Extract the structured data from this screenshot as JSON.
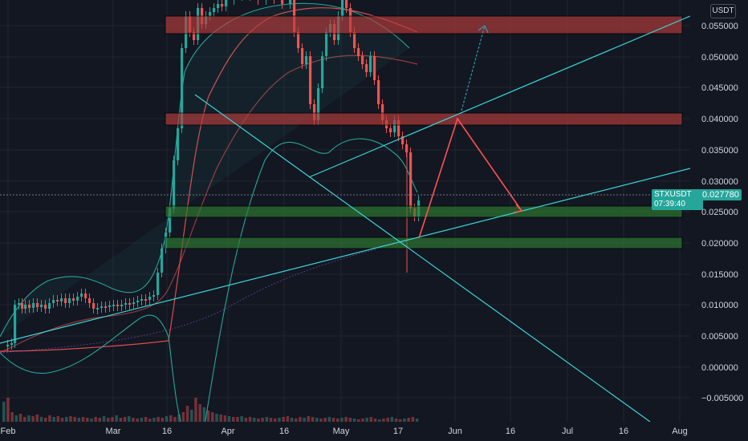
{
  "quote_currency": "USDT",
  "price_tag": {
    "symbol": "STXUSDT",
    "price": "0.027780",
    "countdown": "07:39:40"
  },
  "y_axis_labels": [
    "0.055000",
    "0.050000",
    "0.045000",
    "0.040000",
    "0.035000",
    "0.030000",
    "0.025000",
    "0.020000",
    "0.015000",
    "0.010000",
    "0.005000",
    "0.000000",
    "−0.005000"
  ],
  "x_axis_labels": [
    "Feb",
    "Mar",
    "16",
    "Apr",
    "16",
    "May",
    "17",
    "Jun",
    "16",
    "Jul",
    "16",
    "Aug"
  ],
  "colors": {
    "background": "#131722",
    "bull": "#26a69a",
    "bear": "#ef5350",
    "resistance_zone": "#b83c3c",
    "support_zone": "#2e7d32",
    "trendline": "#3ad5d8",
    "projection_red": "#ff5252"
  }
}
